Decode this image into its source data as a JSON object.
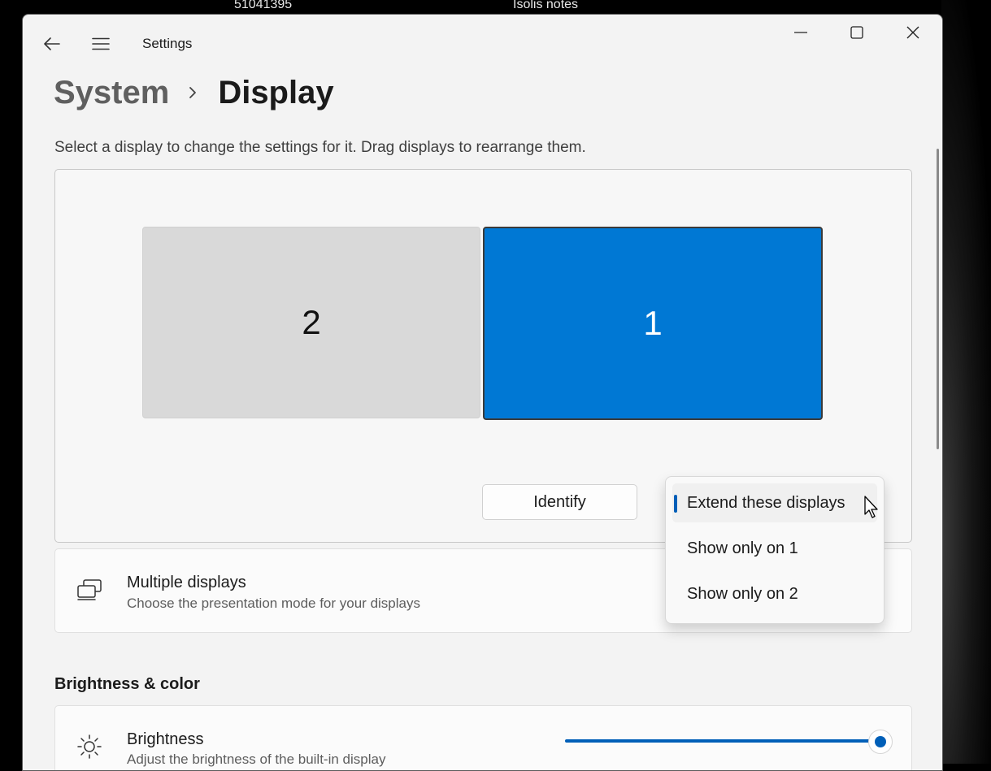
{
  "taskbar": {
    "left_label": "51041395",
    "right_label": "Isolis notes"
  },
  "window": {
    "title": "Settings",
    "back_icon": "back-arrow-icon",
    "menu_icon": "hamburger-menu-icon",
    "controls": [
      "minimize-icon",
      "maximize-icon",
      "close-icon"
    ]
  },
  "breadcrumb": {
    "parent": "System",
    "current": "Display"
  },
  "display_area": {
    "hint": "Select a display to change the settings for it. Drag displays to rearrange them.",
    "monitors": [
      {
        "label": "2",
        "selected": false,
        "color": "#d9d9d9"
      },
      {
        "label": "1",
        "selected": true,
        "color": "#0078d4"
      }
    ],
    "identify_label": "Identify"
  },
  "dropdown": {
    "options": [
      {
        "label": "Extend these displays",
        "selected": true
      },
      {
        "label": "Show only on 1",
        "selected": false
      },
      {
        "label": "Show only on 2",
        "selected": false
      }
    ]
  },
  "multiple_displays": {
    "icon": "multiple-displays-icon",
    "title": "Multiple displays",
    "subtitle": "Choose the presentation mode for your displays"
  },
  "brightness_section": {
    "heading": "Brightness & color",
    "brightness": {
      "icon": "sun-icon",
      "title": "Brightness",
      "subtitle": "Adjust the brightness of the built-in display",
      "value_fraction": 1.0
    }
  },
  "colors": {
    "accent": "#0078d4",
    "slider_accent": "#005fb8",
    "window_bg": "#f3f3f3"
  }
}
